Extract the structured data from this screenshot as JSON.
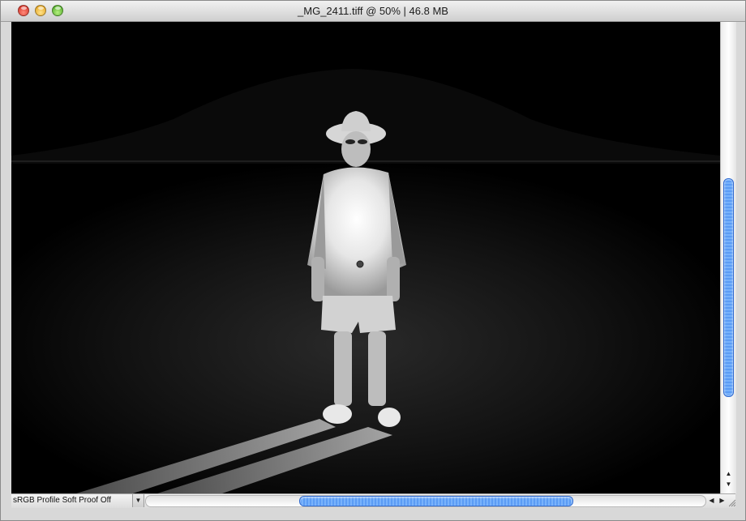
{
  "window": {
    "title": "_MG_2411.tiff @ 50% | 46.8 MB"
  },
  "statusbar": {
    "profile_text": "sRGB Profile  Soft Proof Off",
    "menu_icon": "triangle-down-icon"
  },
  "scroll": {
    "vertical_position": 0.47,
    "horizontal_position": 0.5
  },
  "colors": {
    "scroll_thumb": "#5b9cf5",
    "canvas_background": "#000000"
  }
}
